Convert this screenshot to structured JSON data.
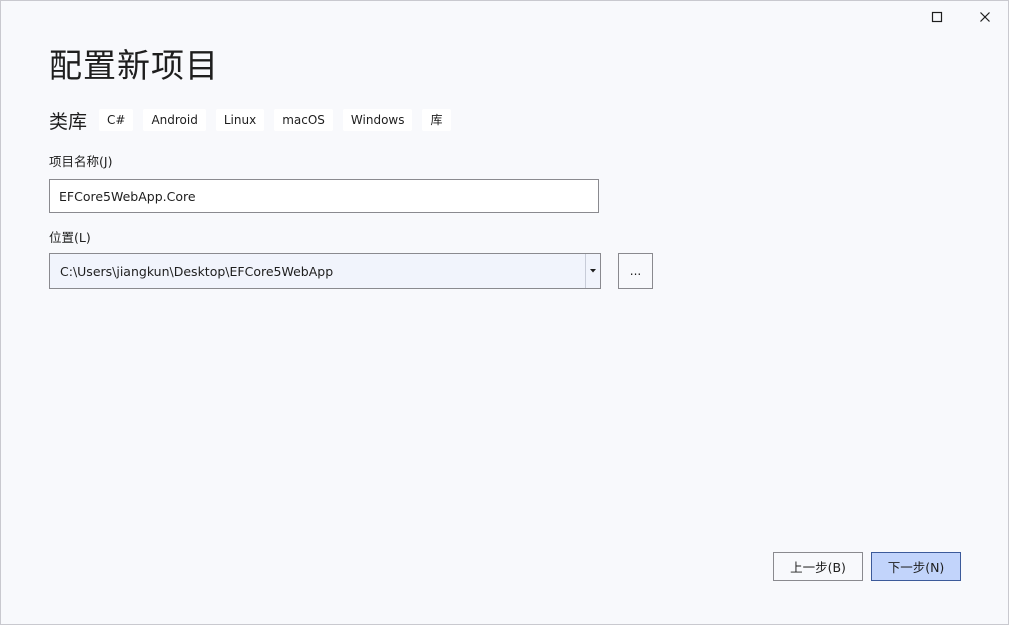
{
  "window": {
    "controls": {
      "maximize_icon": "maximize-icon",
      "close_icon": "close-icon"
    }
  },
  "page": {
    "title": "配置新项目"
  },
  "template": {
    "name": "类库",
    "tags": [
      "C#",
      "Android",
      "Linux",
      "macOS",
      "Windows",
      "库"
    ]
  },
  "form": {
    "project_name": {
      "label": "项目名称(J)",
      "value": "EFCore5WebApp.Core"
    },
    "location": {
      "label": "位置(L)",
      "value": "C:\\Users\\jiangkun\\Desktop\\EFCore5WebApp",
      "dropdown_icon": "caret-down-icon",
      "browse_label": "..."
    }
  },
  "footer": {
    "back_label": "上一步(B)",
    "next_label": "下一步(N)"
  },
  "colors": {
    "background": "#f8f9fc",
    "primary_button": "#c2d4fb",
    "primary_border": "#3c5a9a"
  }
}
